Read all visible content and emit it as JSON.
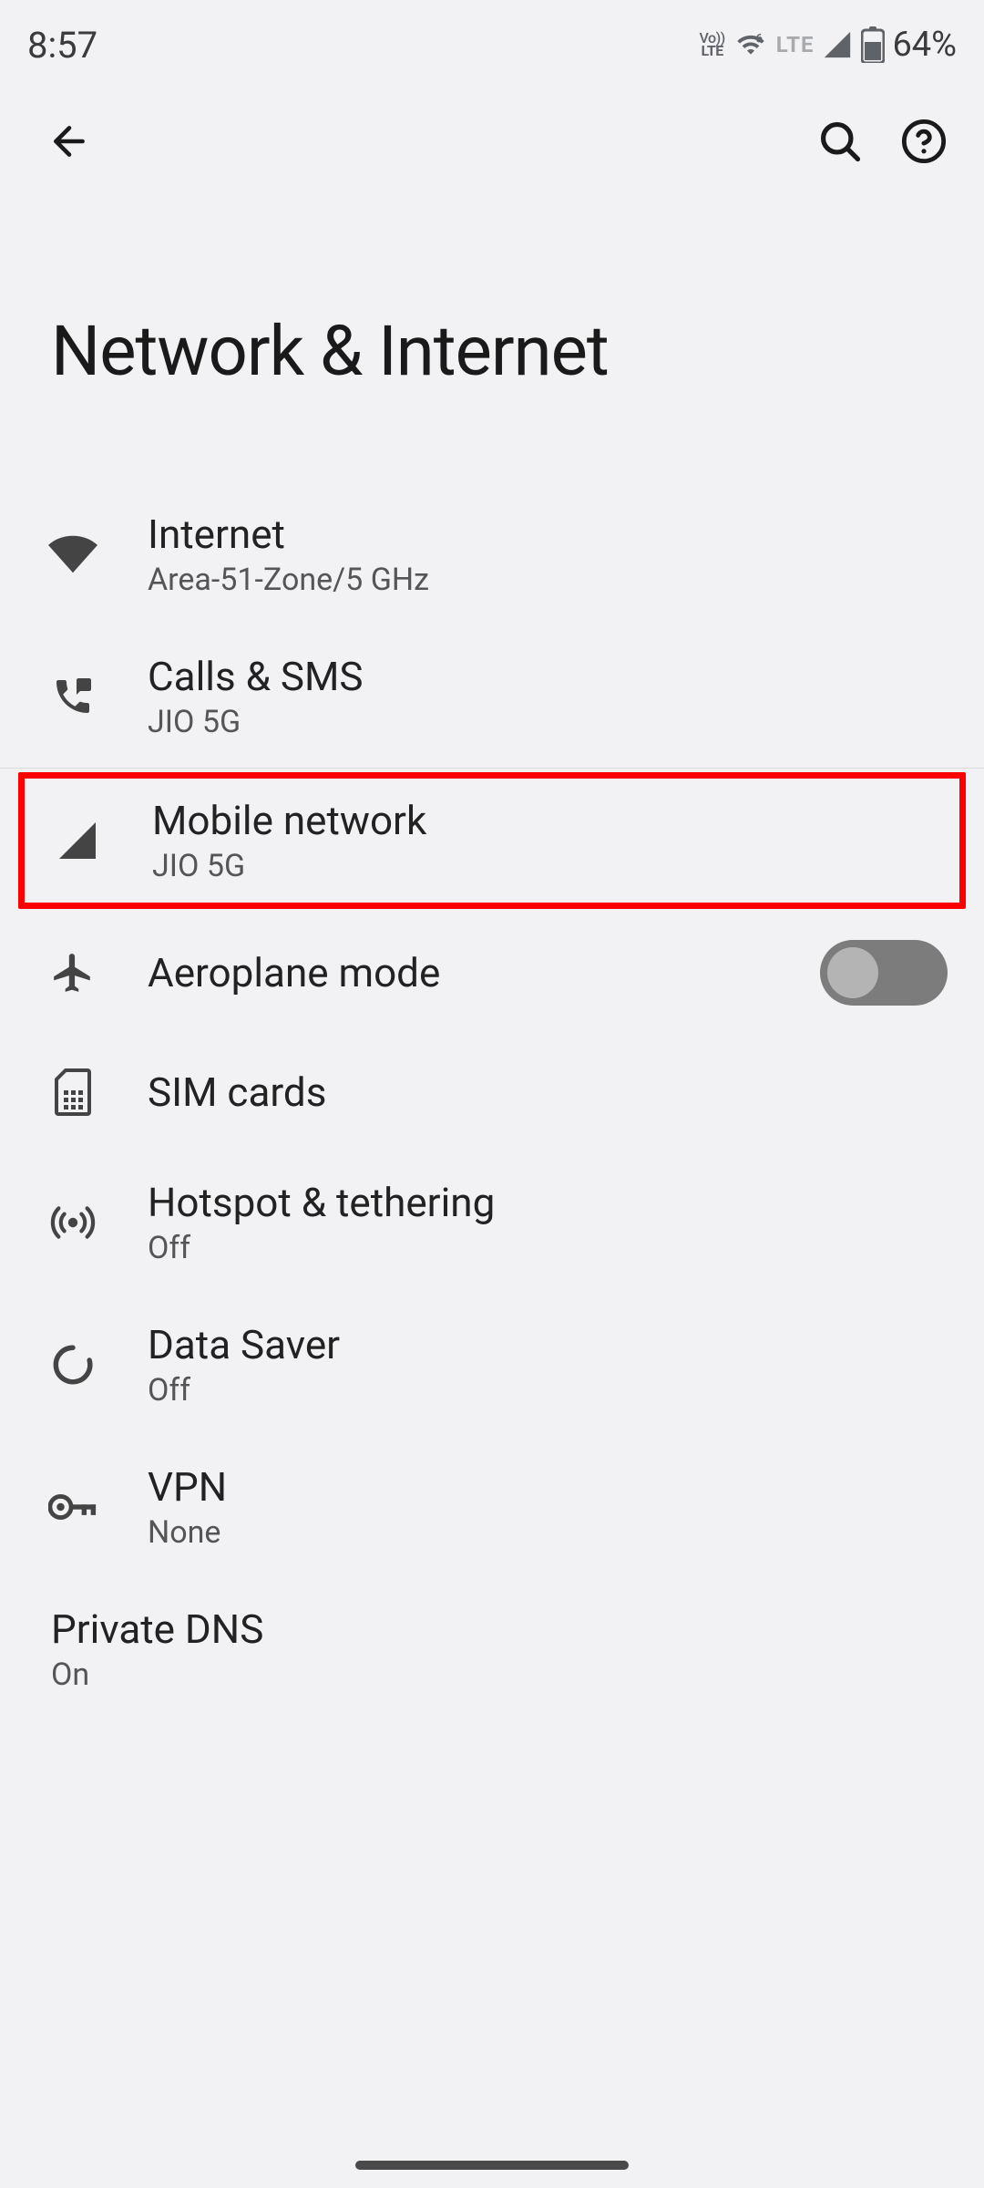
{
  "status": {
    "time": "8:57",
    "volte_top": "Vo)))",
    "volte_bottom": "LTE",
    "lte_label": "LTE",
    "battery_percent": "64%"
  },
  "page": {
    "title": "Network & Internet"
  },
  "items": {
    "internet": {
      "title": "Internet",
      "subtitle": "Area-51-Zone/5 GHz"
    },
    "calls_sms": {
      "title": "Calls & SMS",
      "subtitle": "JIO 5G"
    },
    "mobile_network": {
      "title": "Mobile network",
      "subtitle": "JIO 5G"
    },
    "aeroplane": {
      "title": "Aeroplane mode"
    },
    "sim": {
      "title": "SIM cards"
    },
    "hotspot": {
      "title": "Hotspot & tethering",
      "subtitle": "Off"
    },
    "data_saver": {
      "title": "Data Saver",
      "subtitle": "Off"
    },
    "vpn": {
      "title": "VPN",
      "subtitle": "None"
    },
    "private_dns": {
      "title": "Private DNS",
      "subtitle": "On"
    }
  }
}
